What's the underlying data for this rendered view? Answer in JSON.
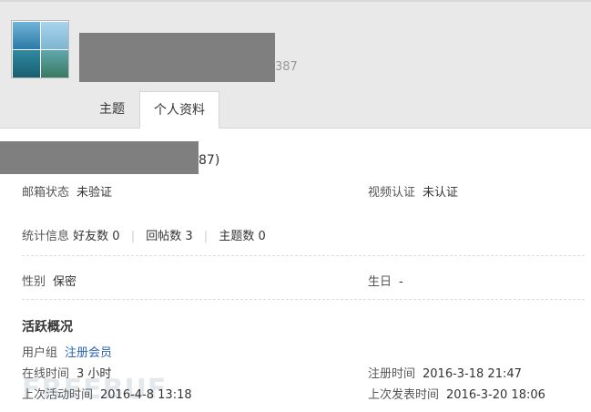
{
  "header": {
    "uid_suffix": "387",
    "tabs": [
      {
        "label": "主题"
      },
      {
        "label": "个人资料"
      }
    ]
  },
  "profile": {
    "uid_tail": "87)",
    "email_status": {
      "label": "邮箱状态",
      "value": "未验证"
    },
    "video_auth": {
      "label": "视频认证",
      "value": "未认证"
    },
    "stats": {
      "label": "统计信息",
      "friends": "好友数 0",
      "replies": "回帖数 3",
      "threads": "主题数 0"
    },
    "gender": {
      "label": "性别",
      "value": "保密"
    },
    "birthday": {
      "label": "生日",
      "value": "-"
    }
  },
  "activity": {
    "title": "活跃概况",
    "group": {
      "label": "用户组",
      "value": "注册会员"
    },
    "online_time": {
      "label": "在线时间",
      "value": "3 小时"
    },
    "register_time": {
      "label": "注册时间",
      "value": "2016-3-18 21:47"
    },
    "last_active": {
      "label": "上次活动时间",
      "value": "2016-4-8 13:18"
    },
    "last_post": {
      "label": "上次发表时间",
      "value": "2016-3-20 18:06"
    }
  },
  "watermark": "FREEBUF",
  "colors": {
    "link": "#2b64b5",
    "header_bg": "#e9e9e9",
    "redaction": "#7f7f7f"
  }
}
